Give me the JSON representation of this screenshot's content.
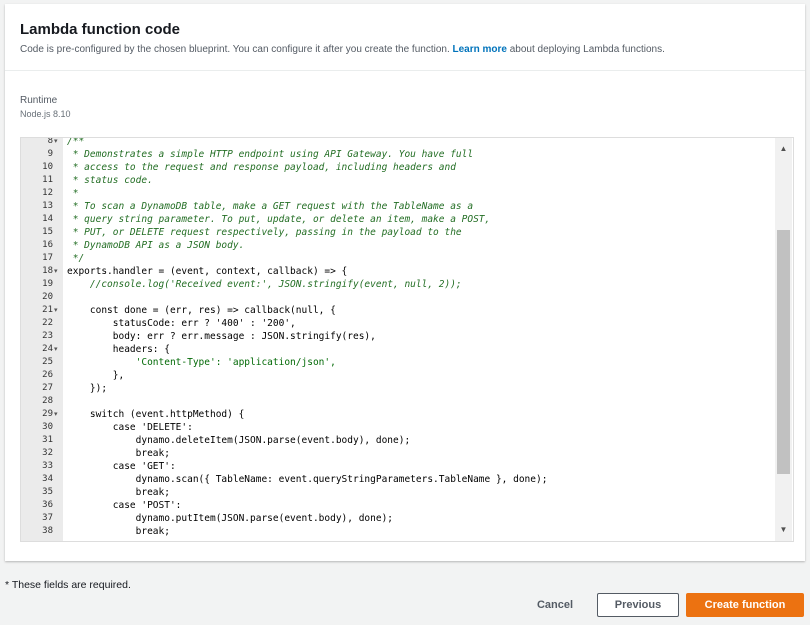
{
  "panel": {
    "title": "Lambda function code",
    "description": "Code is pre-configured by the chosen blueprint. You can configure it after you create the function.",
    "learn_more": "Learn more",
    "description_suffix": "about deploying Lambda functions."
  },
  "runtime": {
    "label": "Runtime",
    "value": "Node.js 8.10"
  },
  "editor": {
    "lines": [
      {
        "n": "8",
        "fold": "▾",
        "t": "/**",
        "c": "cm"
      },
      {
        "n": "9",
        "fold": "",
        "t": " * Demonstrates a simple HTTP endpoint using API Gateway. You have full",
        "c": "cm"
      },
      {
        "n": "10",
        "fold": "",
        "t": " * access to the request and response payload, including headers and",
        "c": "cm"
      },
      {
        "n": "11",
        "fold": "",
        "t": " * status code.",
        "c": "cm"
      },
      {
        "n": "12",
        "fold": "",
        "t": " *",
        "c": "cm"
      },
      {
        "n": "13",
        "fold": "",
        "t": " * To scan a DynamoDB table, make a GET request with the TableName as a",
        "c": "cm"
      },
      {
        "n": "14",
        "fold": "",
        "t": " * query string parameter. To put, update, or delete an item, make a POST,",
        "c": "cm"
      },
      {
        "n": "15",
        "fold": "",
        "t": " * PUT, or DELETE request respectively, passing in the payload to the",
        "c": "cm"
      },
      {
        "n": "16",
        "fold": "",
        "t": " * DynamoDB API as a JSON body.",
        "c": "cm"
      },
      {
        "n": "17",
        "fold": "",
        "t": " */",
        "c": "cm"
      },
      {
        "n": "18",
        "fold": "▾",
        "t": "exports.handler = (event, context, callback) => {",
        "c": ""
      },
      {
        "n": "19",
        "fold": "",
        "t": "    //console.log('Received event:', JSON.stringify(event, null, 2));",
        "c": "cm"
      },
      {
        "n": "20",
        "fold": "",
        "t": "",
        "c": ""
      },
      {
        "n": "21",
        "fold": "▾",
        "t": "    const done = (err, res) => callback(null, {",
        "c": ""
      },
      {
        "n": "22",
        "fold": "",
        "t": "        statusCode: err ? '400' : '200',",
        "c": ""
      },
      {
        "n": "23",
        "fold": "",
        "t": "        body: err ? err.message : JSON.stringify(res),",
        "c": ""
      },
      {
        "n": "24",
        "fold": "▾",
        "t": "        headers: {",
        "c": ""
      },
      {
        "n": "25",
        "fold": "",
        "t": "            'Content-Type': 'application/json',",
        "c": "str"
      },
      {
        "n": "26",
        "fold": "",
        "t": "        },",
        "c": ""
      },
      {
        "n": "27",
        "fold": "",
        "t": "    });",
        "c": ""
      },
      {
        "n": "28",
        "fold": "",
        "t": "",
        "c": ""
      },
      {
        "n": "29",
        "fold": "▾",
        "t": "    switch (event.httpMethod) {",
        "c": ""
      },
      {
        "n": "30",
        "fold": "",
        "t": "        case 'DELETE':",
        "c": ""
      },
      {
        "n": "31",
        "fold": "",
        "t": "            dynamo.deleteItem(JSON.parse(event.body), done);",
        "c": ""
      },
      {
        "n": "32",
        "fold": "",
        "t": "            break;",
        "c": ""
      },
      {
        "n": "33",
        "fold": "",
        "t": "        case 'GET':",
        "c": ""
      },
      {
        "n": "34",
        "fold": "",
        "t": "            dynamo.scan({ TableName: event.queryStringParameters.TableName }, done);",
        "c": ""
      },
      {
        "n": "35",
        "fold": "",
        "t": "            break;",
        "c": ""
      },
      {
        "n": "36",
        "fold": "",
        "t": "        case 'POST':",
        "c": ""
      },
      {
        "n": "37",
        "fold": "",
        "t": "            dynamo.putItem(JSON.parse(event.body), done);",
        "c": ""
      },
      {
        "n": "38",
        "fold": "",
        "t": "            break;",
        "c": ""
      }
    ],
    "scroll_position": 0.3
  },
  "footer": {
    "required_note": "* These fields are required.",
    "cancel": "Cancel",
    "previous": "Previous",
    "create": "Create function"
  },
  "colors": {
    "accent": "#ec7211",
    "link": "#0073bb"
  }
}
